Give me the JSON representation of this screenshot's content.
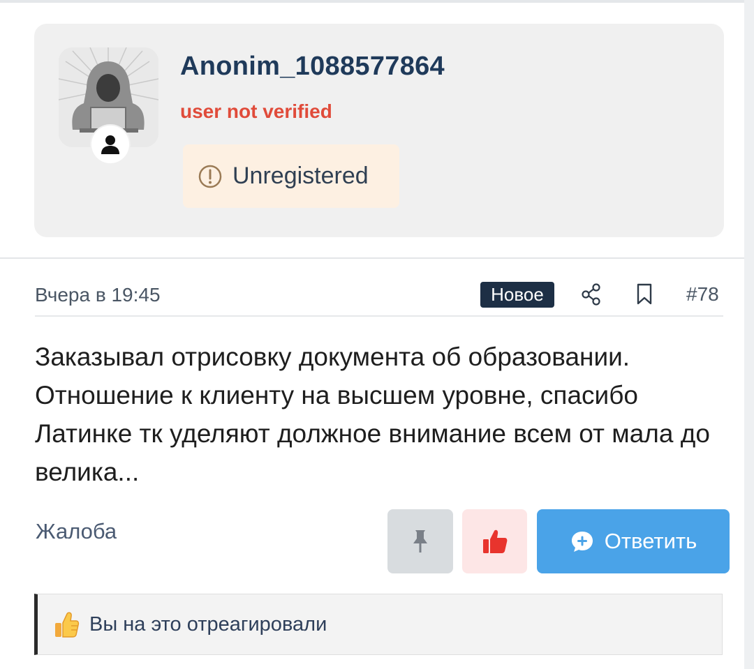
{
  "user": {
    "name": "Anonim_1088577864",
    "verification_status": "user not verified",
    "badge_label": "Unregistered"
  },
  "post": {
    "date": "Вчера в 19:45",
    "new_label": "Новое",
    "number": "#78",
    "text": "Заказывал отрисовку документа об образовании. Отношение к клиенту на высшем уровне, спасибо Латинке тк уделяют должное внимание всем от мала до велика..."
  },
  "actions": {
    "complaint_label": "Жалоба",
    "reply_label": "Ответить"
  },
  "reaction": {
    "text": "Вы на это отреагировали"
  },
  "colors": {
    "username": "#1f3a5a",
    "not_verified": "#e04b3a",
    "new_badge": "#1d2f45",
    "reply_button": "#4aa3e8",
    "like_icon": "#e8342d"
  }
}
